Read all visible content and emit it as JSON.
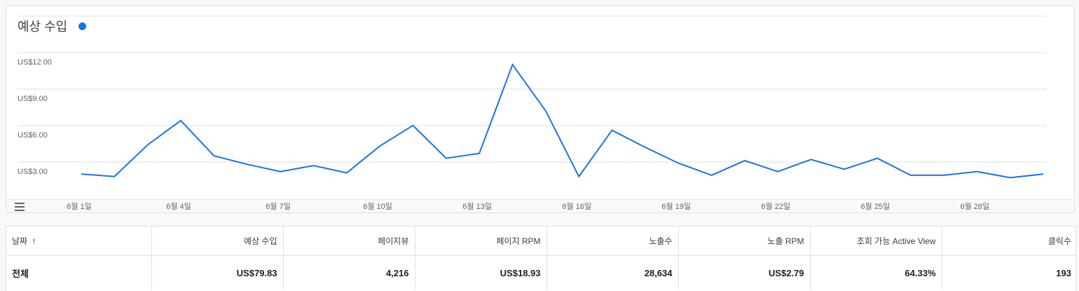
{
  "card": {
    "title": "예상 수입",
    "series_color": "#1a73e8"
  },
  "chart_data": {
    "type": "line",
    "title": "예상 수입",
    "series": [
      {
        "color": "#1a73e8",
        "values": [
          1.2,
          1.0,
          3.6,
          5.6,
          2.7,
          2.0,
          1.4,
          1.9,
          1.3,
          3.5,
          5.2,
          2.5,
          2.9,
          10.2,
          6.4,
          1.0,
          4.8,
          3.4,
          2.1,
          1.1,
          2.3,
          1.4,
          2.4,
          1.6,
          2.5,
          1.1,
          1.1,
          1.4,
          0.9,
          1.2
        ]
      }
    ],
    "x_labels": [
      "6월 1일",
      "6월 4일",
      "6월 7일",
      "6월 10일",
      "6월 13일",
      "6월 16일",
      "6월 19일",
      "6월 22일",
      "6월 25일",
      "6월 28일"
    ],
    "y_ticks": [
      "US$3.00",
      "US$6.00",
      "US$9.00",
      "US$12.00"
    ],
    "y_tick_values": [
      3,
      6,
      9,
      12
    ],
    "ylim": [
      0,
      12
    ],
    "grid": true
  },
  "table": {
    "headers": [
      "날짜",
      "예상 수입",
      "페이지뷰",
      "페이지 RPM",
      "노출수",
      "노출 RPM",
      "조회 가능 Active View",
      "클릭수"
    ],
    "sort_icon": "arrow-up-icon",
    "total_row": [
      "전체",
      "US$79.83",
      "4,216",
      "US$18.93",
      "28,634",
      "US$2.79",
      "64.33%",
      "193"
    ]
  }
}
